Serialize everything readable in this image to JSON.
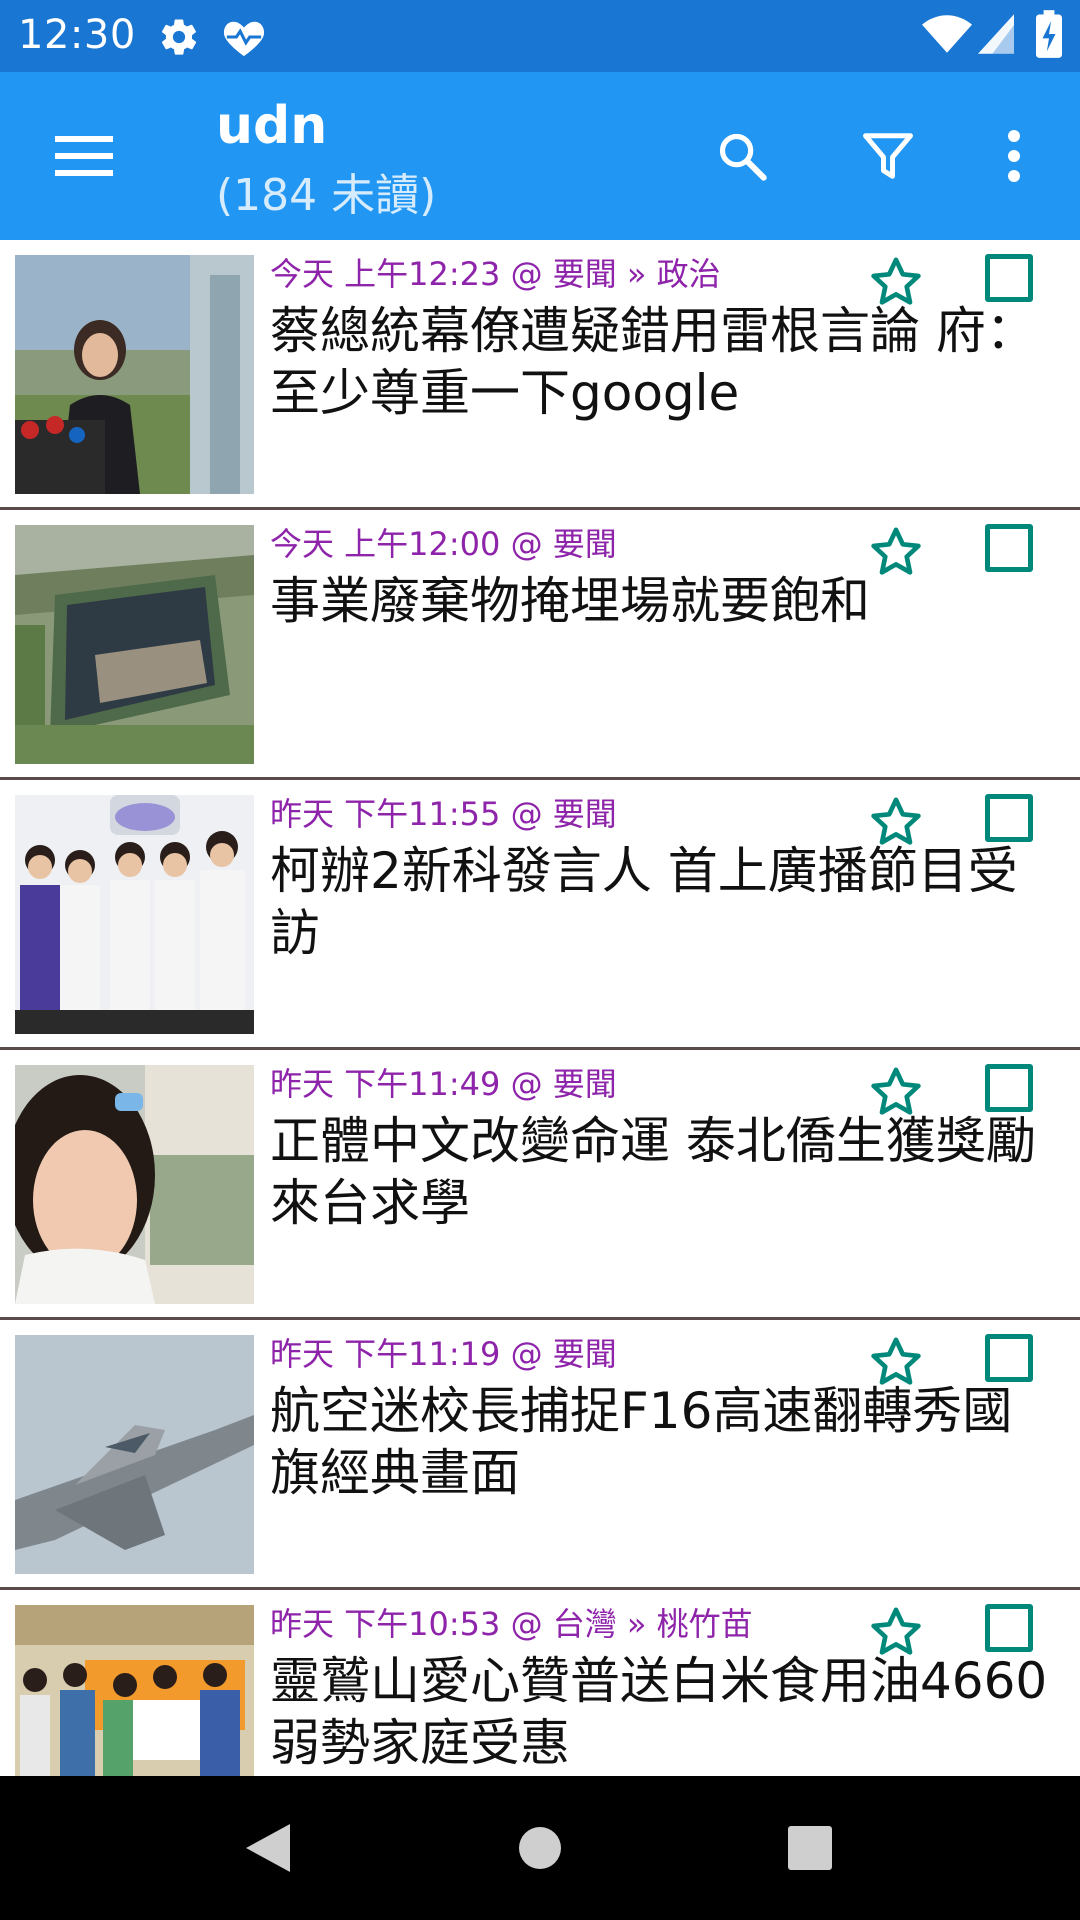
{
  "status_bar": {
    "time": "12:30",
    "icons": [
      "settings-icon",
      "health-heart-icon",
      "wifi-icon",
      "cell-signal-icon",
      "battery-charging-icon"
    ]
  },
  "app_bar": {
    "title": "udn",
    "subtitle": "(184 未讀)",
    "actions": [
      "menu-icon",
      "search-icon",
      "filter-icon",
      "more-vert-icon"
    ]
  },
  "colors": {
    "status_bar": "#1976d2",
    "app_bar": "#2196f3",
    "meta_text": "#8e24aa",
    "accent": "#00897b",
    "divider": "#5b4a4a"
  },
  "feed": {
    "items": [
      {
        "meta": "今天 上午12:23 @ 要聞 » 政治",
        "headline": "蔡總統幕僚遭疑錯用雷根言論 府：至少尊重一下google"
      },
      {
        "meta": "今天 上午12:00 @ 要聞",
        "headline": "事業廢棄物掩埋場就要飽和"
      },
      {
        "meta": "昨天 下午11:55 @ 要聞",
        "headline": "柯辦2新科發言人 首上廣播節目受訪"
      },
      {
        "meta": "昨天 下午11:49 @ 要聞",
        "headline": "正體中文改變命運 泰北僑生獲獎勵來台求學"
      },
      {
        "meta": "昨天 下午11:19 @ 要聞",
        "headline": "航空迷校長捕捉F16高速翻轉秀國旗經典畫面"
      },
      {
        "meta": "昨天 下午10:53 @ 台灣 » 桃竹苗",
        "headline": "靈鷲山愛心贊普送白米食用油4660弱勢家庭受惠"
      }
    ]
  },
  "nav_bar": {
    "buttons": [
      "back-icon",
      "home-icon",
      "recents-icon"
    ]
  }
}
